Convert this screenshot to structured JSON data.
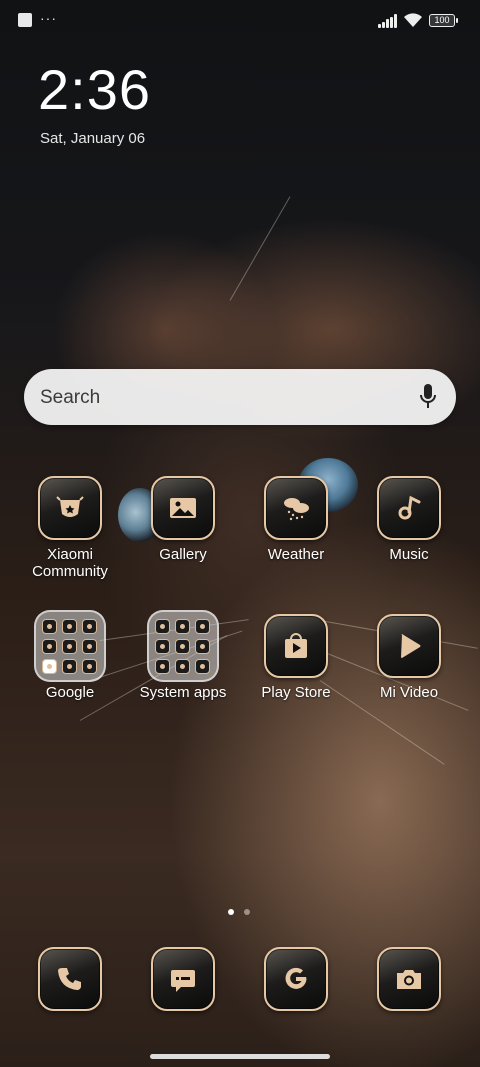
{
  "status_bar": {
    "notif_dots": "···",
    "battery": "100"
  },
  "lock": {
    "time": "2:36",
    "date": "Sat, January 06"
  },
  "search": {
    "placeholder": "Search"
  },
  "apps": [
    {
      "label": "Xiaomi\nCommunity",
      "icon": "xiaomi-community-icon"
    },
    {
      "label": "Gallery",
      "icon": "gallery-icon"
    },
    {
      "label": "Weather",
      "icon": "weather-icon"
    },
    {
      "label": "Music",
      "icon": "music-icon"
    },
    {
      "label": "Google",
      "icon": "google-folder-icon"
    },
    {
      "label": "System apps",
      "icon": "system-apps-folder-icon"
    },
    {
      "label": "Play Store",
      "icon": "play-store-icon"
    },
    {
      "label": "Mi Video",
      "icon": "mi-video-icon"
    }
  ],
  "dock": [
    {
      "icon": "phone-icon"
    },
    {
      "icon": "messages-icon"
    },
    {
      "icon": "google-icon"
    },
    {
      "icon": "camera-icon"
    }
  ],
  "pages": {
    "count": 2,
    "current": 1
  },
  "colors": {
    "accent": "#e6c8a6",
    "icon_bg": "#111111"
  }
}
